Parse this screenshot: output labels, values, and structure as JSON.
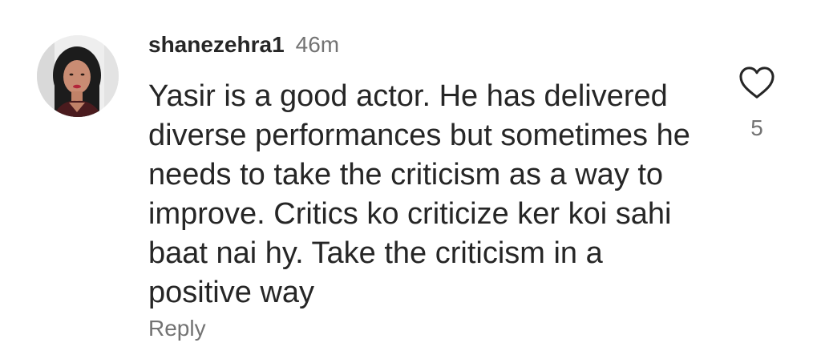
{
  "comment": {
    "username": "shanezehra1",
    "time": "46m",
    "text": "Yasir is a good actor. He has delivered diverse performances but sometimes he needs to take the criticism as a way to improve. Critics ko criticize ker koi sahi baat nai hy. Take the criticism in a positive way",
    "reply_label": "Reply",
    "like_count": "5",
    "like_icon": "heart-outline-icon"
  },
  "colors": {
    "primary_text": "#262626",
    "secondary_text": "#737373",
    "background": "#ffffff"
  }
}
